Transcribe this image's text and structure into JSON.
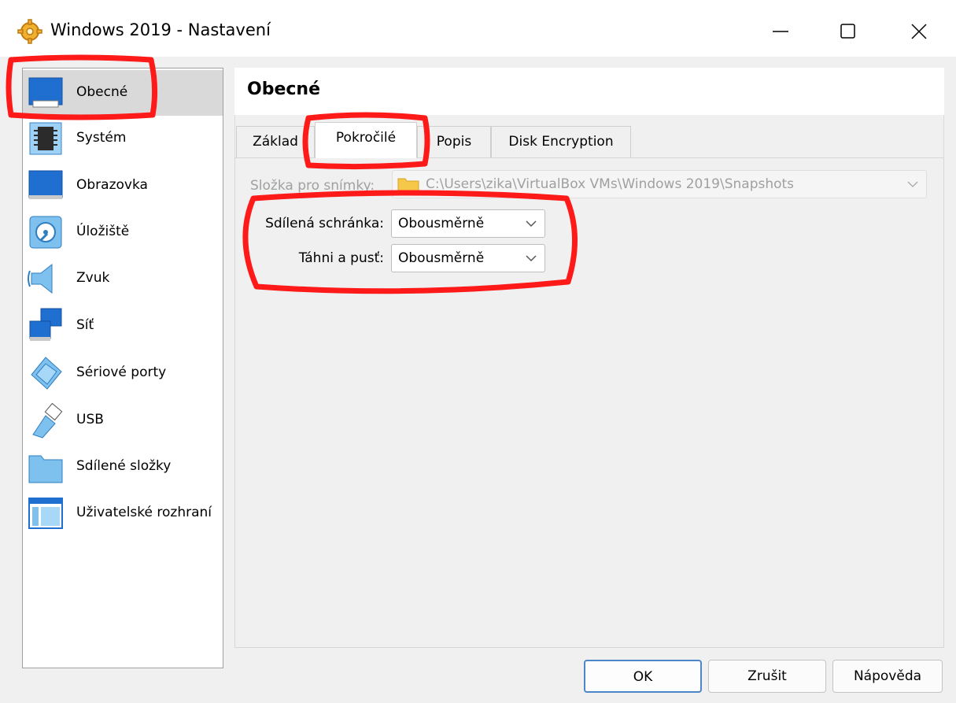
{
  "window": {
    "title": "Windows 2019 - Nastavení",
    "icon": "gear-icon",
    "controls": [
      "minimize-icon",
      "maximize-icon",
      "close-icon"
    ]
  },
  "sidebar": {
    "items": [
      {
        "label": "Obecné",
        "icon": "monitor-icon",
        "selected": true
      },
      {
        "label": "Systém",
        "icon": "chip-icon"
      },
      {
        "label": "Obrazovka",
        "icon": "display-icon"
      },
      {
        "label": "Úložiště",
        "icon": "storage-disk-icon"
      },
      {
        "label": "Zvuk",
        "icon": "speaker-icon"
      },
      {
        "label": "Síť",
        "icon": "network-icon"
      },
      {
        "label": "Sériové porty",
        "icon": "serial-port-icon"
      },
      {
        "label": "USB",
        "icon": "usb-icon"
      },
      {
        "label": "Sdílené složky",
        "icon": "folder-icon"
      },
      {
        "label": "Uživatelské rozhraní",
        "icon": "window-layout-icon"
      }
    ]
  },
  "page": {
    "title": "Obecné",
    "tabs": [
      {
        "label": "Základ"
      },
      {
        "label": "Pokročilé",
        "active": true
      },
      {
        "label": "Popis"
      },
      {
        "label": "Disk Encryption"
      }
    ]
  },
  "advanced": {
    "snapshot_folder_label": "Složka pro snímky:",
    "snapshot_folder_value": "C:\\Users\\zika\\VirtualBox VMs\\Windows 2019\\Snapshots",
    "clipboard_label": "Sdílená schránka:",
    "clipboard_value": "Obousměrně",
    "dragdrop_label": "Táhni a pusť:",
    "dragdrop_value": "Obousměrně"
  },
  "buttons": {
    "ok": "OK",
    "cancel": "Zrušit",
    "help": "Nápověda"
  },
  "colors": {
    "annotation": "#ff1a1a",
    "accent_blue": "#1f6fd0",
    "selected_bg": "#d9d9d9"
  }
}
